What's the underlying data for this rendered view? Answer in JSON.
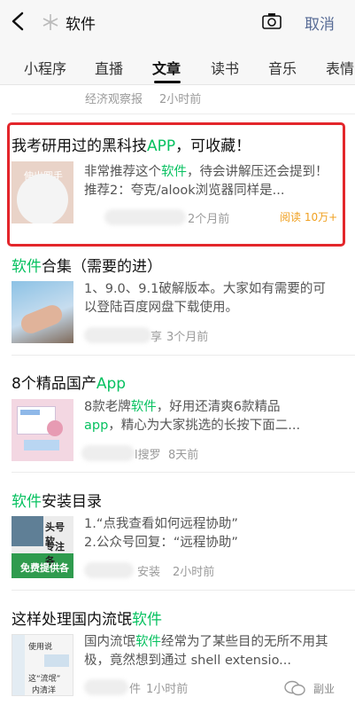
{
  "header": {
    "query": "软件",
    "cancel_label": "取消"
  },
  "tabs": [
    "小程序",
    "直播",
    "文章",
    "读书",
    "音乐",
    "表情"
  ],
  "prev_item": {
    "source": "经济观察报",
    "time": "2小时前"
  },
  "articles": [
    {
      "title_pre": "我考研用过的黑科技",
      "title_hl": "APP",
      "title_post": "，可收藏！",
      "snippet_pre": "非常推荐这个",
      "snippet_hl": "软件",
      "snippet_post": "，待会讲解压还会提到！推荐2：夸克/alook浏览器同样是...",
      "time": "2个月前",
      "read": "阅读 10万+",
      "thumb_text": "伸出圆手"
    },
    {
      "title_pre": "",
      "title_hl": "软件",
      "title_post": "合集（需要的进）",
      "snippet": "1、9.0、9.1破解版本。大家如有需要的可以登陆百度网盘下载使用。",
      "source_tail": "享",
      "time": "3个月前"
    },
    {
      "title_pre": "8个精品国产",
      "title_hl": "App",
      "title_post": "",
      "snippet_pre": "8款老牌",
      "snippet_hl": "软件",
      "snippet_mid": "，好用还清爽6款精品",
      "snippet_hl2": "app",
      "snippet_post": "，精心为大家挑选的长按下面二...",
      "source_tail": "l搜罗",
      "time": "8天前"
    },
    {
      "title_pre": "",
      "title_hl": "软件",
      "title_post": "安装目录",
      "snippet": "1.“点我查看如何远程协助”\n2.公众号回复：“远程协助”",
      "source_tail": "安装",
      "time": "2小时前",
      "thumb_lines": [
        "头号软",
        "专注各",
        "免费提供各"
      ]
    },
    {
      "title_pre": "这样处理国内流氓",
      "title_hl": "软件",
      "title_post": "",
      "snippet_pre": "国内流氓",
      "snippet_hl": "软件",
      "snippet_post": "经常为了某些目的无所不用其极，竟然想到通过 shell extensio...",
      "source_tail": "件",
      "time": "1小时前",
      "thumb_lines": [
        "使用说",
        "这“流氓”",
        "内清洋"
      ]
    }
  ],
  "watermark": "副业"
}
